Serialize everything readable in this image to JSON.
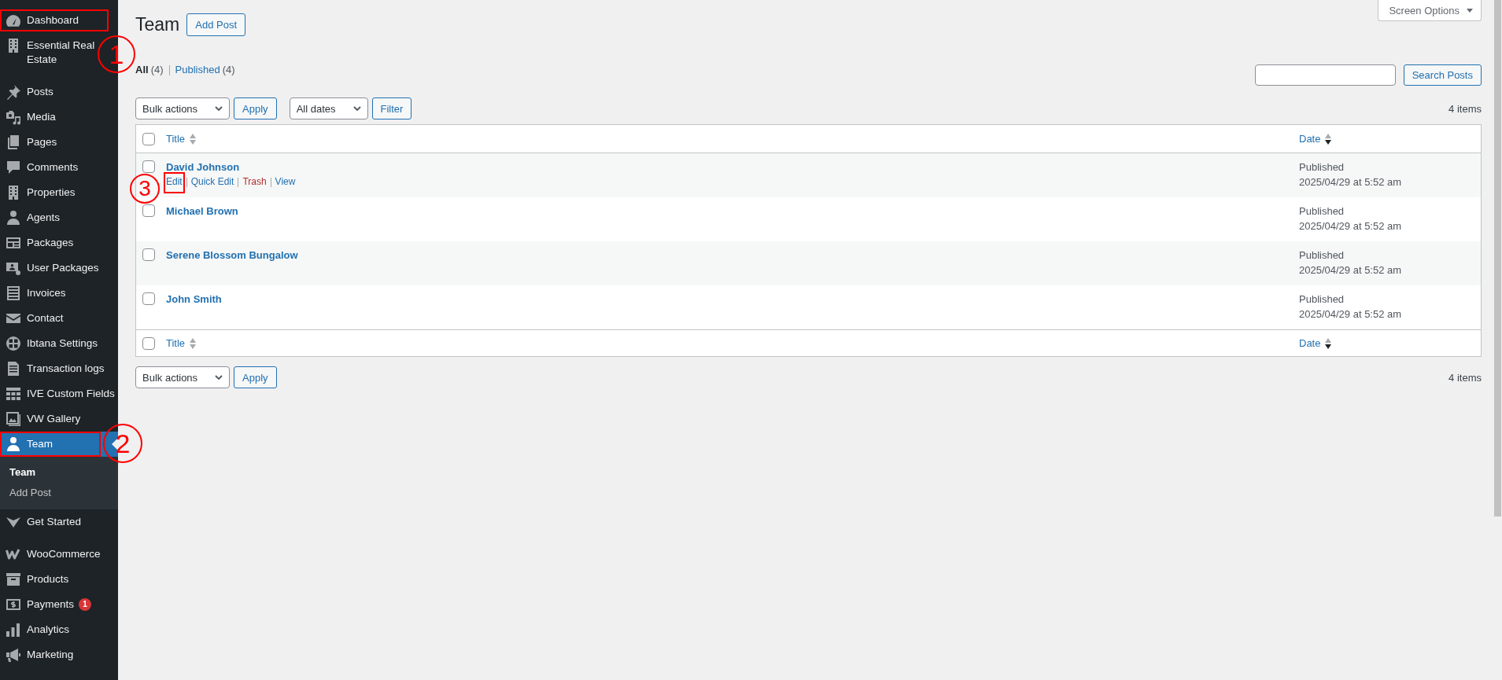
{
  "sidebar": {
    "groups": [
      {
        "items": [
          {
            "label": "Dashboard",
            "selected": false,
            "step": "1"
          },
          {
            "label": "Essential Real Estate",
            "selected": false
          }
        ]
      },
      {
        "items": [
          {
            "label": "Posts",
            "selected": false
          },
          {
            "label": "Media",
            "selected": false
          },
          {
            "label": "Pages",
            "selected": false
          },
          {
            "label": "Comments",
            "selected": false
          },
          {
            "label": "Properties",
            "selected": false
          },
          {
            "label": "Agents",
            "selected": false
          },
          {
            "label": "Packages",
            "selected": false
          },
          {
            "label": "User Packages",
            "selected": false
          },
          {
            "label": "Invoices",
            "selected": false
          },
          {
            "label": "Contact",
            "selected": false
          },
          {
            "label": "Ibtana Settings",
            "selected": false
          },
          {
            "label": "Transaction logs",
            "selected": false
          },
          {
            "label": "IVE Custom Fields",
            "selected": false
          },
          {
            "label": "VW Gallery",
            "selected": false
          },
          {
            "label": "Team",
            "selected": true,
            "step": "2",
            "submenu": [
              {
                "label": "Team",
                "selected": true
              },
              {
                "label": "Add Post",
                "selected": false
              }
            ]
          },
          {
            "label": "Get Started",
            "selected": false
          }
        ]
      },
      {
        "items": [
          {
            "label": "WooCommerce",
            "selected": false
          },
          {
            "label": "Products",
            "selected": false
          },
          {
            "label": "Payments",
            "selected": false,
            "badge": "1"
          },
          {
            "label": "Analytics",
            "selected": false
          },
          {
            "label": "Marketing",
            "selected": false
          }
        ]
      }
    ]
  },
  "screen_options": {
    "label": "Screen Options"
  },
  "header": {
    "title": "Team",
    "add_button": "Add Post"
  },
  "views": [
    {
      "label": "All",
      "count": "(4)",
      "selected": true
    },
    {
      "label": "Published",
      "count": "(4)",
      "selected": false
    }
  ],
  "search": {
    "button": "Search Posts"
  },
  "tablenav_top": {
    "bulk_action": "Bulk actions",
    "apply": "Apply",
    "date_filter": "All dates",
    "filter": "Filter",
    "count": "4 items"
  },
  "table": {
    "select_all_checked": false,
    "columns": [
      {
        "label": "Title",
        "sorted": false
      },
      {
        "label": "Date",
        "sorted": true
      }
    ],
    "rows": [
      {
        "title": "David Johnson",
        "checked": false,
        "status": "Published",
        "date": "2025/04/29 at 5:52 am",
        "actions": [
          {
            "label": "Edit",
            "kind": "link",
            "step": "3"
          },
          {
            "label": "Quick Edit",
            "kind": "link"
          },
          {
            "label": "Trash",
            "kind": "delete"
          },
          {
            "label": "View",
            "kind": "link"
          }
        ]
      },
      {
        "title": "Michael Brown",
        "checked": false,
        "status": "Published",
        "date": "2025/04/29 at 5:52 am"
      },
      {
        "title": "Serene Blossom Bungalow",
        "checked": false,
        "status": "Published",
        "date": "2025/04/29 at 5:52 am"
      },
      {
        "title": "John Smith",
        "checked": false,
        "status": "Published",
        "date": "2025/04/29 at 5:52 am"
      }
    ],
    "footer_select_all_checked": false,
    "footer_columns": [
      {
        "label": "Title",
        "sorted": false
      },
      {
        "label": "Date",
        "sorted": true
      }
    ]
  },
  "tablenav_bottom": {
    "bulk_action": "Bulk actions",
    "apply": "Apply",
    "count": "4 items"
  }
}
